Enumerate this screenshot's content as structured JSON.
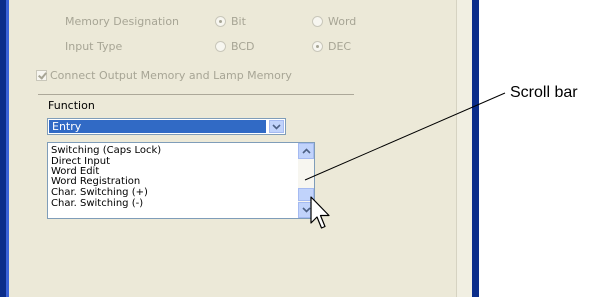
{
  "settings": {
    "memory_designation": {
      "label": "Memory Designation",
      "options": [
        {
          "label": "Bit",
          "checked": true
        },
        {
          "label": "Word",
          "checked": false
        }
      ]
    },
    "input_type": {
      "label": "Input Type",
      "options": [
        {
          "label": "BCD",
          "checked": false
        },
        {
          "label": "DEC",
          "checked": true
        }
      ]
    },
    "connect_memory": {
      "label": "Connect Output Memory and Lamp Memory",
      "checked": true
    }
  },
  "function": {
    "label": "Function",
    "selected": "Entry",
    "items": [
      "Switching (Caps Lock)",
      "Direct Input",
      "Word Edit",
      "Word Registration",
      "Char. Switching (+)",
      "Char. Switching (-)"
    ]
  },
  "annotation": {
    "label": "Scroll bar"
  },
  "colors": {
    "window_frame": "#0b2d8a",
    "panel_bg": "#ece9d8",
    "selection": "#316ac5",
    "scroll_button": "#c1d3fb",
    "disabled_text": "#a7a595"
  },
  "icons": {
    "combo_arrow": "chevron-down-icon",
    "scroll_up": "chevron-up-icon",
    "scroll_down": "chevron-down-icon",
    "pointer": "mouse-cursor-icon"
  }
}
